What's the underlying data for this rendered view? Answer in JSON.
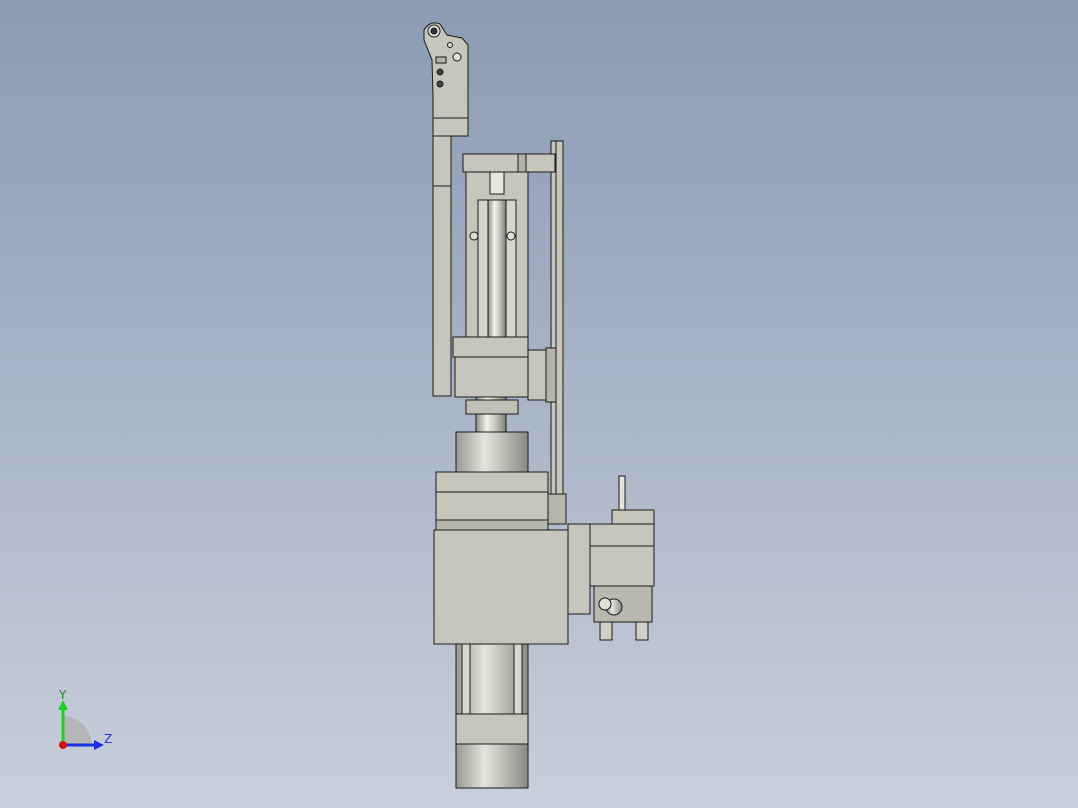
{
  "viewport": {
    "background_top": "#8a9bb2",
    "background_bottom": "#c9cfdb"
  },
  "triad": {
    "y_label": "Y",
    "z_label": "Z",
    "y_color": "#1fd11f",
    "z_color": "#1a2fe0",
    "x_color": "#d01010"
  },
  "model": {
    "part_fill": "#c6c6bc",
    "part_dark": "#8f8f86",
    "edge_color": "#1a1a1a"
  }
}
